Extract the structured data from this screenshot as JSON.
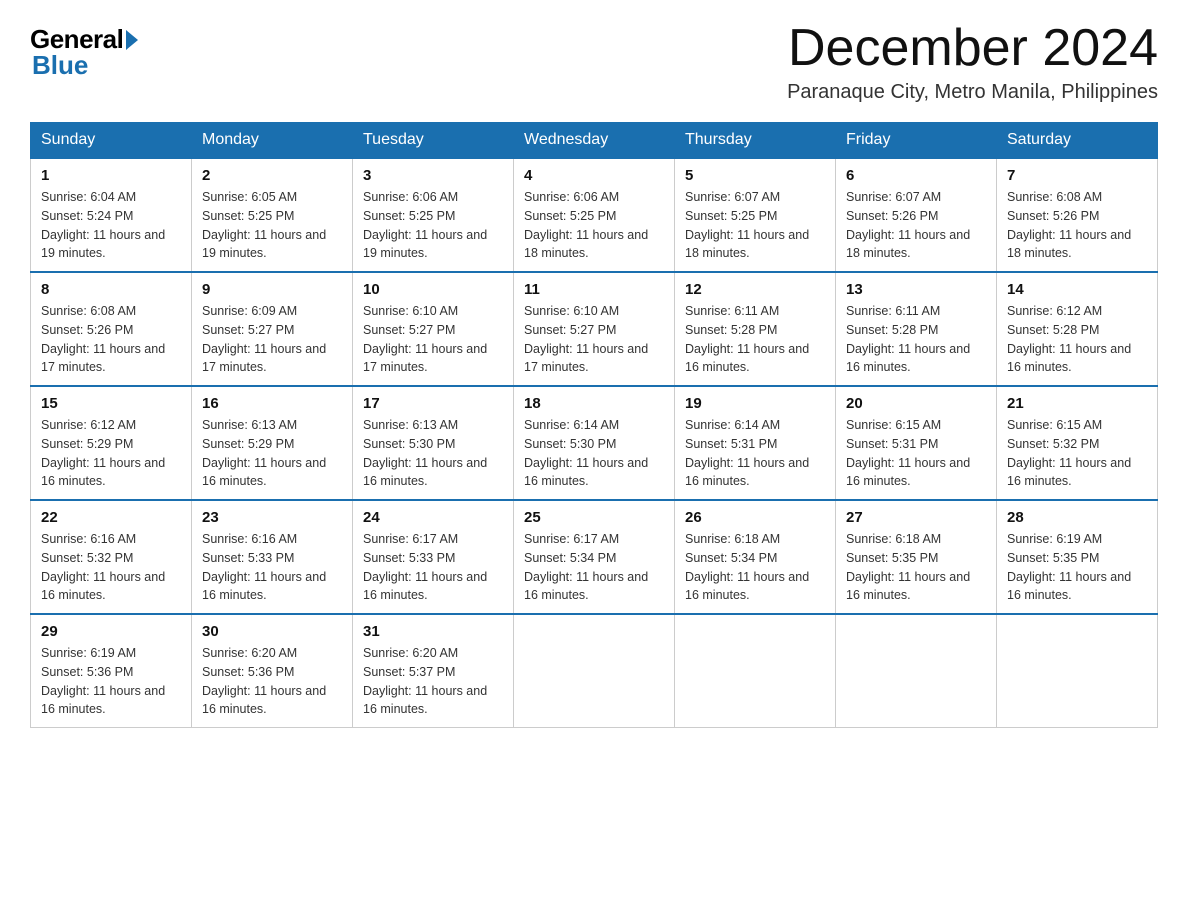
{
  "header": {
    "logo_general": "General",
    "logo_blue": "Blue",
    "month_year": "December 2024",
    "location": "Paranaque City, Metro Manila, Philippines"
  },
  "days_of_week": [
    "Sunday",
    "Monday",
    "Tuesday",
    "Wednesday",
    "Thursday",
    "Friday",
    "Saturday"
  ],
  "weeks": [
    [
      {
        "day": "1",
        "sunrise": "6:04 AM",
        "sunset": "5:24 PM",
        "daylight": "11 hours and 19 minutes."
      },
      {
        "day": "2",
        "sunrise": "6:05 AM",
        "sunset": "5:25 PM",
        "daylight": "11 hours and 19 minutes."
      },
      {
        "day": "3",
        "sunrise": "6:06 AM",
        "sunset": "5:25 PM",
        "daylight": "11 hours and 19 minutes."
      },
      {
        "day": "4",
        "sunrise": "6:06 AM",
        "sunset": "5:25 PM",
        "daylight": "11 hours and 18 minutes."
      },
      {
        "day": "5",
        "sunrise": "6:07 AM",
        "sunset": "5:25 PM",
        "daylight": "11 hours and 18 minutes."
      },
      {
        "day": "6",
        "sunrise": "6:07 AM",
        "sunset": "5:26 PM",
        "daylight": "11 hours and 18 minutes."
      },
      {
        "day": "7",
        "sunrise": "6:08 AM",
        "sunset": "5:26 PM",
        "daylight": "11 hours and 18 minutes."
      }
    ],
    [
      {
        "day": "8",
        "sunrise": "6:08 AM",
        "sunset": "5:26 PM",
        "daylight": "11 hours and 17 minutes."
      },
      {
        "day": "9",
        "sunrise": "6:09 AM",
        "sunset": "5:27 PM",
        "daylight": "11 hours and 17 minutes."
      },
      {
        "day": "10",
        "sunrise": "6:10 AM",
        "sunset": "5:27 PM",
        "daylight": "11 hours and 17 minutes."
      },
      {
        "day": "11",
        "sunrise": "6:10 AM",
        "sunset": "5:27 PM",
        "daylight": "11 hours and 17 minutes."
      },
      {
        "day": "12",
        "sunrise": "6:11 AM",
        "sunset": "5:28 PM",
        "daylight": "11 hours and 16 minutes."
      },
      {
        "day": "13",
        "sunrise": "6:11 AM",
        "sunset": "5:28 PM",
        "daylight": "11 hours and 16 minutes."
      },
      {
        "day": "14",
        "sunrise": "6:12 AM",
        "sunset": "5:28 PM",
        "daylight": "11 hours and 16 minutes."
      }
    ],
    [
      {
        "day": "15",
        "sunrise": "6:12 AM",
        "sunset": "5:29 PM",
        "daylight": "11 hours and 16 minutes."
      },
      {
        "day": "16",
        "sunrise": "6:13 AM",
        "sunset": "5:29 PM",
        "daylight": "11 hours and 16 minutes."
      },
      {
        "day": "17",
        "sunrise": "6:13 AM",
        "sunset": "5:30 PM",
        "daylight": "11 hours and 16 minutes."
      },
      {
        "day": "18",
        "sunrise": "6:14 AM",
        "sunset": "5:30 PM",
        "daylight": "11 hours and 16 minutes."
      },
      {
        "day": "19",
        "sunrise": "6:14 AM",
        "sunset": "5:31 PM",
        "daylight": "11 hours and 16 minutes."
      },
      {
        "day": "20",
        "sunrise": "6:15 AM",
        "sunset": "5:31 PM",
        "daylight": "11 hours and 16 minutes."
      },
      {
        "day": "21",
        "sunrise": "6:15 AM",
        "sunset": "5:32 PM",
        "daylight": "11 hours and 16 minutes."
      }
    ],
    [
      {
        "day": "22",
        "sunrise": "6:16 AM",
        "sunset": "5:32 PM",
        "daylight": "11 hours and 16 minutes."
      },
      {
        "day": "23",
        "sunrise": "6:16 AM",
        "sunset": "5:33 PM",
        "daylight": "11 hours and 16 minutes."
      },
      {
        "day": "24",
        "sunrise": "6:17 AM",
        "sunset": "5:33 PM",
        "daylight": "11 hours and 16 minutes."
      },
      {
        "day": "25",
        "sunrise": "6:17 AM",
        "sunset": "5:34 PM",
        "daylight": "11 hours and 16 minutes."
      },
      {
        "day": "26",
        "sunrise": "6:18 AM",
        "sunset": "5:34 PM",
        "daylight": "11 hours and 16 minutes."
      },
      {
        "day": "27",
        "sunrise": "6:18 AM",
        "sunset": "5:35 PM",
        "daylight": "11 hours and 16 minutes."
      },
      {
        "day": "28",
        "sunrise": "6:19 AM",
        "sunset": "5:35 PM",
        "daylight": "11 hours and 16 minutes."
      }
    ],
    [
      {
        "day": "29",
        "sunrise": "6:19 AM",
        "sunset": "5:36 PM",
        "daylight": "11 hours and 16 minutes."
      },
      {
        "day": "30",
        "sunrise": "6:20 AM",
        "sunset": "5:36 PM",
        "daylight": "11 hours and 16 minutes."
      },
      {
        "day": "31",
        "sunrise": "6:20 AM",
        "sunset": "5:37 PM",
        "daylight": "11 hours and 16 minutes."
      },
      null,
      null,
      null,
      null
    ]
  ]
}
